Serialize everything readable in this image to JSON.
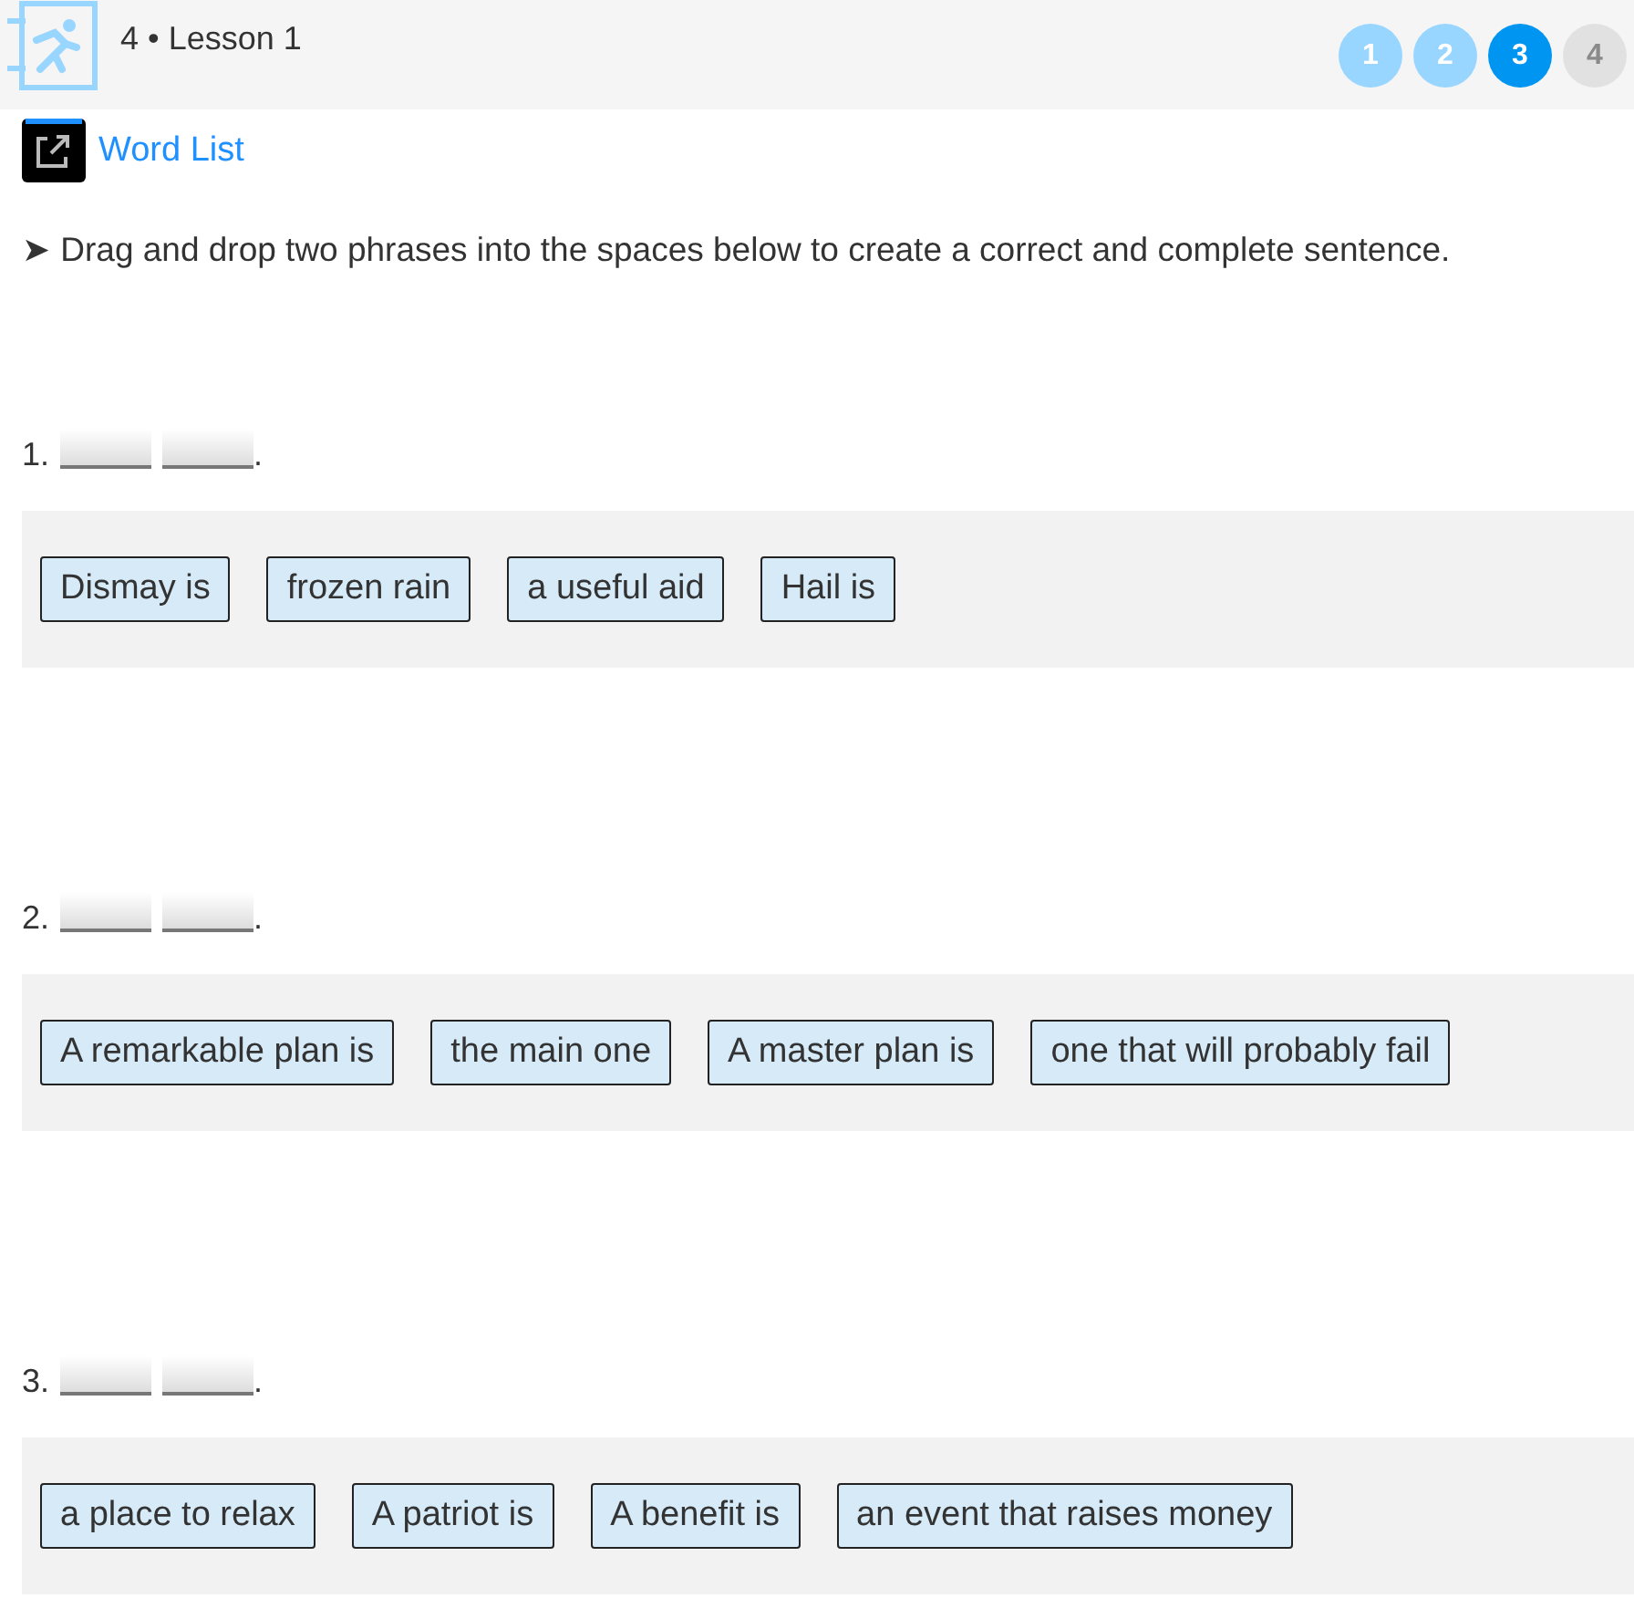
{
  "header": {
    "title": "4 • Lesson 1",
    "steps": [
      {
        "label": "1",
        "selected": false,
        "completed": true
      },
      {
        "label": "2",
        "selected": false,
        "completed": true
      },
      {
        "label": "3",
        "selected": true,
        "completed": false
      },
      {
        "label": "4",
        "selected": false,
        "completed": false
      }
    ]
  },
  "word_list_link": "Word List",
  "instruction": "➤ Drag and drop two phrases into the spaces below to create a correct and complete sentence.",
  "questions": [
    {
      "number": "1.",
      "end": ".",
      "phrases": [
        "Dismay is",
        "frozen rain",
        "a useful aid",
        "Hail is"
      ]
    },
    {
      "number": "2.",
      "end": ".",
      "phrases": [
        "A remarkable plan is",
        "the main one",
        "A master plan is",
        "one that will probably fail"
      ]
    },
    {
      "number": "3.",
      "end": ".",
      "phrases": [
        "a place to relax",
        "A patriot is",
        "A benefit is",
        "an event that raises money"
      ]
    }
  ]
}
